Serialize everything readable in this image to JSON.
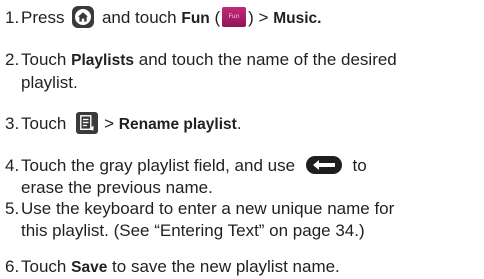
{
  "steps": [
    {
      "num": "1.",
      "p1": "Press",
      "p2": "and touch",
      "fun_bold": "Fun",
      "open_paren": "(",
      "fun_icon_label": "Fun",
      "close_part": ") >",
      "music_bold": "Music.",
      "icons": [
        "home-key-icon",
        "fun-app-icon"
      ]
    },
    {
      "num": "2.",
      "p1": "Touch",
      "playlists_bold": "Playlists",
      "p2": "and touch the name of the desired",
      "line2": "playlist."
    },
    {
      "num": "3.",
      "p1": "Touch",
      "gt": ">",
      "rename_bold": "Rename playlist",
      "end": ".",
      "icons": [
        "menu-key-icon"
      ]
    },
    {
      "num": "4.",
      "p1": "Touch the gray playlist field, and use",
      "p2": "to",
      "line2": "erase the previous name.",
      "icons": [
        "backspace-key-icon"
      ]
    },
    {
      "num": "5.",
      "line1": "Use the keyboard to enter a new unique name for",
      "line2": "this playlist. (See “Entering Text” on page 34.)"
    },
    {
      "num": "6.",
      "p1": "Touch",
      "save_bold": "Save",
      "p2": "to save the new playlist name."
    }
  ]
}
